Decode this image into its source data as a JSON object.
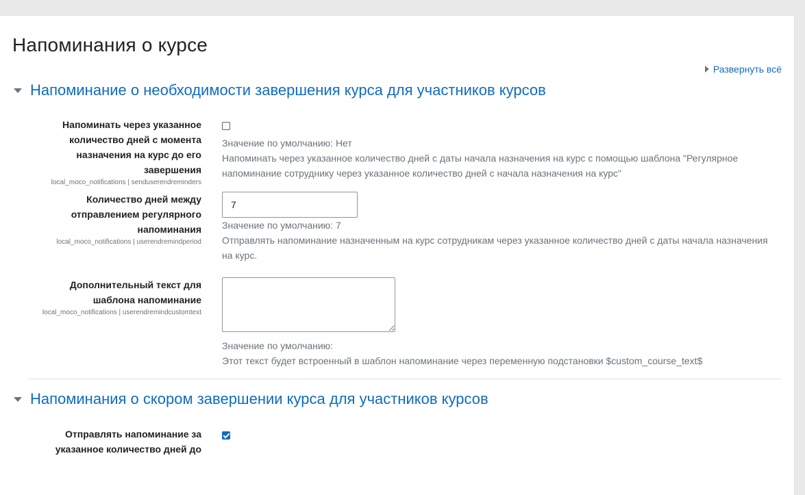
{
  "page": {
    "title": "Напоминания о курсе",
    "expand_all": "Развернуть всё"
  },
  "sections": [
    {
      "title": "Напоминание о необходимости завершения курса для участников курсов",
      "settings": [
        {
          "label": "Напоминать через указанное количество дней с момента назначения на курс до его завершения",
          "varname": "local_moco_notifications | senduserendreminders",
          "type": "checkbox",
          "checked": false,
          "default": "Значение по умолчанию: Нет",
          "description": "Напоминать через указанное количество дней с даты начала назначения на курс с помощью шаблона \"Регулярное напоминание сотруднику через указанное количество дней с начала назначения на курс\""
        },
        {
          "label": "Количество дней между отправлением регулярного напоминания",
          "varname": "local_moco_notifications | userendremindperiod",
          "type": "text",
          "value": "7",
          "default": "Значение по умолчанию: 7",
          "description": "Отправлять напоминание назначенным на курс сотрудникам через указанное количество дней с даты начала назначения на курс."
        },
        {
          "label": "Дополнительный текст для шаблона напоминание",
          "varname": "local_moco_notifications | userendremindcustomtext",
          "type": "textarea",
          "value": "",
          "default": "Значение по умолчанию:",
          "description": "Этот текст будет встроенный в шаблон напоминание через переменную подстановки $custom_course_text$"
        }
      ]
    },
    {
      "title": "Напоминания о скором завершении курса для участников курсов",
      "settings": [
        {
          "label": "Отправлять напоминание за указанное количество дней до",
          "type": "checkbox",
          "checked": true
        }
      ]
    }
  ],
  "colors": {
    "accent": "#0f6cbf",
    "muted_text": "#6a737b",
    "background": "#e9e9e9"
  }
}
